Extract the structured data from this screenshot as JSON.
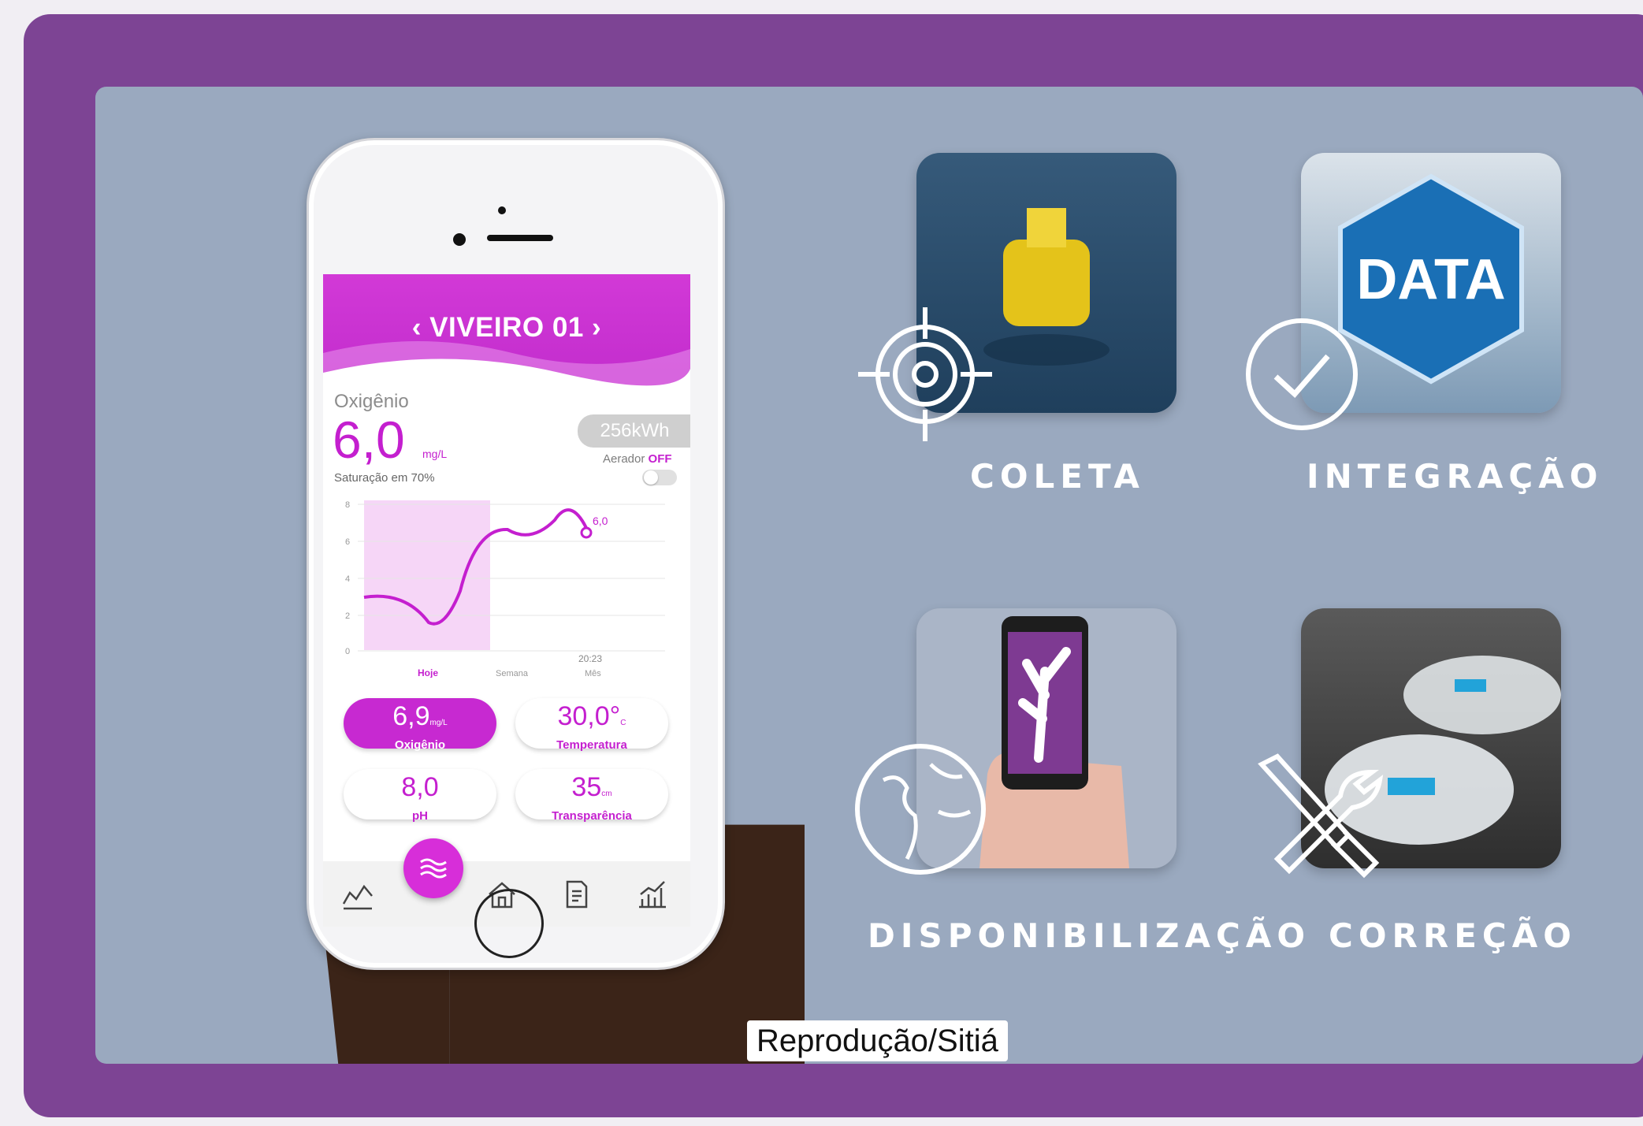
{
  "phone": {
    "title": "‹ VIVEIRO 01 ›",
    "oxygen_label": "Oxigênio",
    "oxygen_value": "6,0",
    "oxygen_unit": "mg/L",
    "saturation": "Saturação em 70%",
    "energy": "256kWh",
    "aerator_label": "Aerador",
    "aerator_state": "OFF",
    "chart_last_value": "6,0",
    "chart_time": "20:23",
    "y_ticks": [
      "8",
      "6",
      "4",
      "2",
      "0"
    ],
    "ranges": [
      "Hoje",
      "Semana",
      "Mês"
    ],
    "metrics": [
      {
        "value": "6,9",
        "unit": "mg/L",
        "label": "Oxigênio"
      },
      {
        "value": "30,0°",
        "unit": "C",
        "label": "Temperatura"
      },
      {
        "value": "8,0",
        "unit": "",
        "label": "pH"
      },
      {
        "value": "35",
        "unit": "cm",
        "label": "Transparência"
      }
    ]
  },
  "steps": [
    {
      "label": "COLETA",
      "icon": "target-icon"
    },
    {
      "label": "INTEGRAÇÃO",
      "icon": "check-circle-icon",
      "tile_text": "DATA"
    },
    {
      "label": "DISPONIBILIZAÇÃO",
      "icon": "globe-icon"
    },
    {
      "label": "CORREÇÃO",
      "icon": "tools-icon"
    }
  ],
  "caption": "Reprodução/Sitiá",
  "colors": {
    "frame": "#7d4494",
    "panel": "#9aa9bf",
    "accent": "#c41fcf"
  }
}
